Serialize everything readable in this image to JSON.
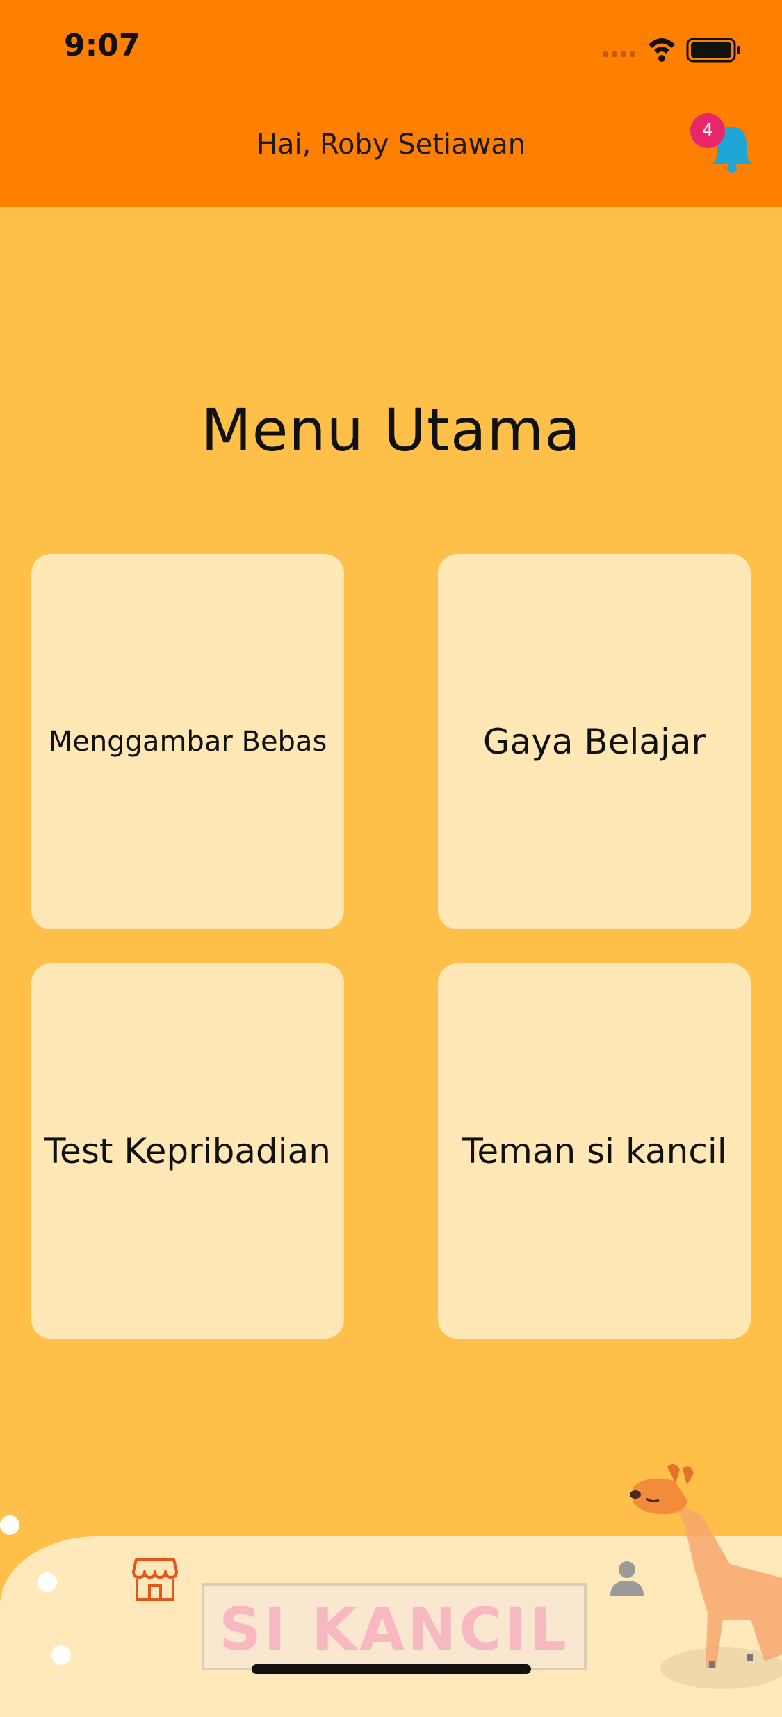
{
  "status_bar": {
    "time": "9:07"
  },
  "header": {
    "greeting": "Hai, Roby Setiawan",
    "notification_count": "4"
  },
  "main": {
    "title": "Menu Utama",
    "menu_items": [
      {
        "label": "Menggambar Bebas"
      },
      {
        "label": "Gaya Belajar"
      },
      {
        "label": "Test Kepribadian"
      },
      {
        "label": "Teman si kancil"
      }
    ]
  },
  "bottom_bar": {
    "brand_text": "SI KANCIL",
    "left_icon": "store-icon",
    "right_icon": "user-icon"
  },
  "colors": {
    "header": "#FF8001",
    "background": "#FFC04A",
    "card": "#FFE8B5",
    "badge": "#E8266B",
    "bell": "#1EA6D6"
  }
}
